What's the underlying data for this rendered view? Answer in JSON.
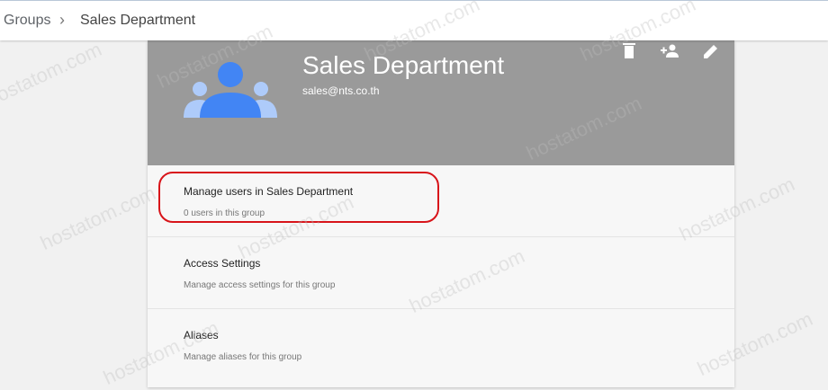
{
  "breadcrumb": {
    "root": "Groups",
    "separator": "›",
    "current": "Sales Department"
  },
  "group": {
    "name": "Sales Department",
    "email": "sales@nts.co.th"
  },
  "actions": [
    {
      "icon": "trash-icon"
    },
    {
      "icon": "add-member-icon"
    },
    {
      "icon": "pencil-icon"
    }
  ],
  "rows": [
    {
      "title": "Manage users in Sales Department",
      "subtitle": "0 users in this group"
    },
    {
      "title": "Access Settings",
      "subtitle": "Manage access settings for this group"
    },
    {
      "title": "Aliases",
      "subtitle": "Manage aliases for this group"
    }
  ],
  "watermark": "hostatom.com",
  "colors": {
    "hero": "#9a9a9a",
    "avatar_primary": "#4285f4",
    "avatar_secondary": "#aecbfa",
    "highlight": "#d8141a"
  }
}
